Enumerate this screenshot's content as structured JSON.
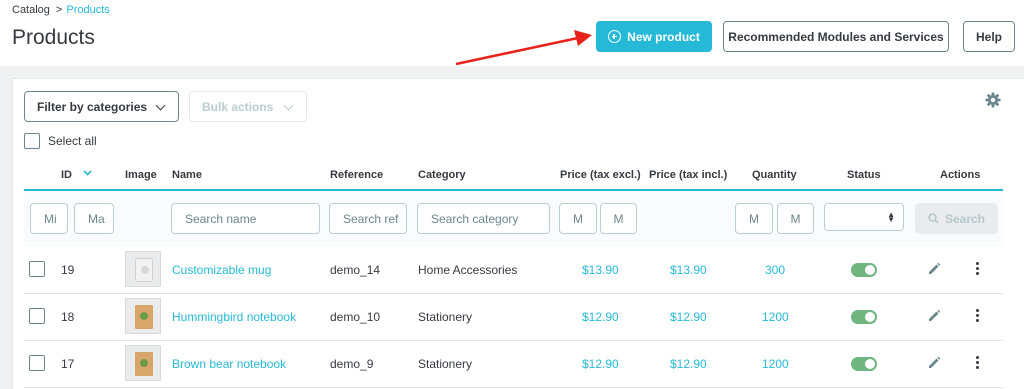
{
  "breadcrumb": {
    "parent": "Catalog",
    "separator": ">",
    "current": "Products"
  },
  "page_title": "Products",
  "toolbar": {
    "new_product": "New product",
    "recommended": "Recommended Modules and Services",
    "help": "Help"
  },
  "filters": {
    "filter_by_categories": "Filter by categories",
    "bulk_actions": "Bulk actions",
    "select_all": "Select all"
  },
  "columns": {
    "id": "ID",
    "image": "Image",
    "name": "Name",
    "reference": "Reference",
    "category": "Category",
    "price_excl": "Price (tax excl.)",
    "price_incl": "Price (tax incl.)",
    "quantity": "Quantity",
    "status": "Status",
    "actions": "Actions"
  },
  "filter_inputs": {
    "id_min": "Mi",
    "id_max": "Ma",
    "name": "Search name",
    "reference": "Search ref",
    "category": "Search category",
    "price_min": "M",
    "price_max": "M",
    "qty_min": "M",
    "qty_max": "M",
    "search_button": "Search"
  },
  "rows": [
    {
      "id": "19",
      "name": "Customizable mug",
      "reference": "demo_14",
      "category": "Home Accessories",
      "price_excl": "$13.90",
      "price_incl": "$13.90",
      "quantity": "300",
      "status": "enabled"
    },
    {
      "id": "18",
      "name": "Hummingbird notebook",
      "reference": "demo_10",
      "category": "Stationery",
      "price_excl": "$12.90",
      "price_incl": "$12.90",
      "quantity": "1200",
      "status": "enabled"
    },
    {
      "id": "17",
      "name": "Brown bear notebook",
      "reference": "demo_9",
      "category": "Stationery",
      "price_excl": "$12.90",
      "price_incl": "$12.90",
      "quantity": "1200",
      "status": "enabled"
    }
  ],
  "colors": {
    "accent": "#25b9d7",
    "toggle_on": "#70b580",
    "arrow": "#e8221b"
  }
}
